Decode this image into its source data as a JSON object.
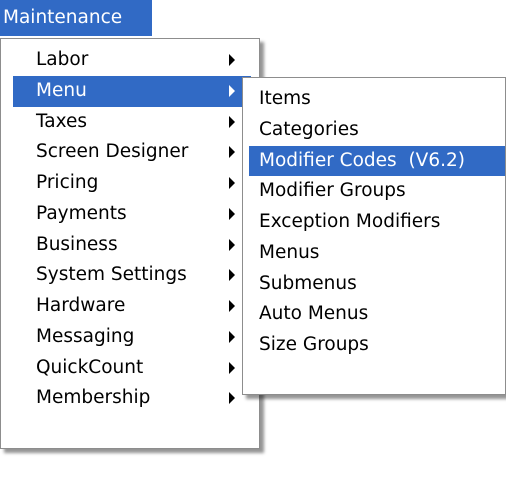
{
  "menubar": {
    "maintenance_label": "Maintenance"
  },
  "maintenance_menu": {
    "items": [
      {
        "label": "Labor",
        "has_submenu": true
      },
      {
        "label": "Menu",
        "has_submenu": true,
        "highlighted": true
      },
      {
        "label": "Taxes",
        "has_submenu": true
      },
      {
        "label": "Screen Designer",
        "has_submenu": true
      },
      {
        "label": "Pricing",
        "has_submenu": true
      },
      {
        "label": "Payments",
        "has_submenu": true
      },
      {
        "label": "Business",
        "has_submenu": true
      },
      {
        "label": "System Settings",
        "has_submenu": true
      },
      {
        "label": "Hardware",
        "has_submenu": true
      },
      {
        "label": "Messaging",
        "has_submenu": true
      },
      {
        "label": "QuickCount",
        "has_submenu": true
      },
      {
        "label": "Membership",
        "has_submenu": true
      }
    ]
  },
  "menu_submenu": {
    "items": [
      {
        "label": "Items"
      },
      {
        "label": "Categories"
      },
      {
        "label": "Modifier Codes  (V6.2)",
        "highlighted": true
      },
      {
        "label": "Modifier Groups"
      },
      {
        "label": "Exception Modifiers"
      },
      {
        "label": "Menus"
      },
      {
        "label": "Submenus"
      },
      {
        "label": "Auto Menus"
      },
      {
        "label": "Size Groups"
      }
    ]
  },
  "colors": {
    "highlight": "#316ac5",
    "highlight_text": "#ffffff",
    "menu_background": "#ffffff",
    "menu_border": "#8d8d8d"
  }
}
